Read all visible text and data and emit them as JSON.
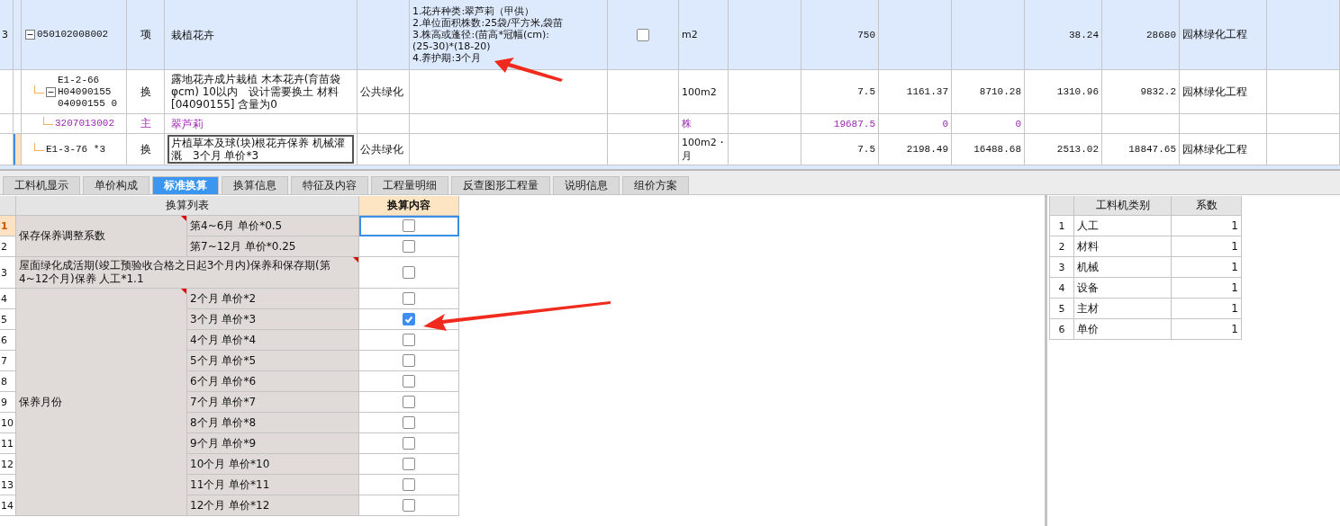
{
  "bill_table": {
    "rows": [
      {
        "kind": "bill",
        "num": "3",
        "code": "050102008002",
        "type": "项",
        "name": "栽植花卉",
        "features": [
          "1.花卉种类:翠芦莉（甲供）",
          "2.单位面积株数:25袋/平方米,袋苗",
          "3.株高或蓬径:(苗高*冠幅(cm):",
          "(25-30)*(18-20)",
          "4.养护期:3个月"
        ],
        "checked": false,
        "unit": "m2",
        "quantity": "750",
        "column_14": "38.24",
        "column_15": "28680",
        "specialty": "园林绿化工程",
        "selected": false,
        "expanded": true,
        "children": [
          {
            "kind": "quota",
            "code": "E1-2-66 H04090155 04090155 0",
            "type": "换",
            "name": "露地花卉成片栽植 木本花卉(育苗袋φcm) 10以内　设计需要换土 材料[04090155] 含量为0",
            "category": "公共绿化",
            "unit": "100m2",
            "quantity": "7.5",
            "column_12": "1161.37",
            "column_13": "8710.28",
            "column_14": "1310.96",
            "column_15": "9832.2",
            "specialty": "园林绿化工程",
            "selected": false,
            "expanded": true,
            "children": [
              {
                "kind": "material",
                "code": "3207013002",
                "type": "主",
                "name": "翠芦莉",
                "unit": "株",
                "quantity": "19687.5",
                "column_12": "0",
                "column_13": "0",
                "selected": false
              }
            ]
          },
          {
            "kind": "quota",
            "code": "E1-3-76 *3",
            "type": "换",
            "name": "片植草本及球(块)根花卉保养 机械灌溉　3个月 单价*3",
            "category": "公共绿化",
            "unit": "100m2・月",
            "quantity": "7.5",
            "column_12": "2198.49",
            "column_13": "16488.68",
            "column_14": "2513.02",
            "column_15": "18847.65",
            "specialty": "园林绿化工程",
            "selected": true
          }
        ]
      }
    ]
  },
  "tabs": [
    {
      "label": "工料机显示",
      "selected": false
    },
    {
      "label": "单价构成",
      "selected": false
    },
    {
      "label": "标准换算",
      "selected": true
    },
    {
      "label": "换算信息",
      "selected": false
    },
    {
      "label": "特征及内容",
      "selected": false
    },
    {
      "label": "工程量明细",
      "selected": false
    },
    {
      "label": "反查图形工程量",
      "selected": false
    },
    {
      "label": "说明信息",
      "selected": false
    },
    {
      "label": "组价方案",
      "selected": false
    }
  ],
  "conversion_table": {
    "columns": [
      "换算列表",
      "换算内容"
    ],
    "groups": [
      {
        "kind": "grouped",
        "label": "保存保养调整系数",
        "note_mark": true,
        "rows": [
          {
            "num": "1",
            "item": "第4~6月 单价*0.5",
            "checked": false,
            "selected": true
          },
          {
            "num": "2",
            "item": "第7~12月 单价*0.25",
            "checked": false,
            "selected": false
          }
        ]
      },
      {
        "kind": "merged",
        "label": "屋面绿化成活期(竣工预验收合格之日起3个月内)保养和保存期(第4~12个月)保养 人工*1.1",
        "note_mark": true,
        "rows": [
          {
            "num": "3",
            "checked": false,
            "selected": false
          }
        ]
      },
      {
        "kind": "grouped",
        "label": "保养月份",
        "note_mark": true,
        "rows": [
          {
            "num": "4",
            "item": "2个月 单价*2",
            "checked": false,
            "selected": false
          },
          {
            "num": "5",
            "item": "3个月 单价*3",
            "checked": true,
            "selected": false
          },
          {
            "num": "6",
            "item": "4个月 单价*4",
            "checked": false,
            "selected": false
          },
          {
            "num": "7",
            "item": "5个月 单价*5",
            "checked": false,
            "selected": false
          },
          {
            "num": "8",
            "item": "6个月 单价*6",
            "checked": false,
            "selected": false
          },
          {
            "num": "9",
            "item": "7个月 单价*7",
            "checked": false,
            "selected": false
          },
          {
            "num": "10",
            "item": "8个月 单价*8",
            "checked": false,
            "selected": false
          },
          {
            "num": "11",
            "item": "9个月 单价*9",
            "checked": false,
            "selected": false
          },
          {
            "num": "12",
            "item": "10个月 单价*10",
            "checked": false,
            "selected": false
          },
          {
            "num": "13",
            "item": "11个月 单价*11",
            "checked": false,
            "selected": false
          },
          {
            "num": "14",
            "item": "12个月 单价*12",
            "checked": false,
            "selected": false
          }
        ]
      }
    ]
  },
  "coefficient_table": {
    "columns": [
      "工料机类别",
      "系数"
    ],
    "rows": [
      {
        "num": "1",
        "category": "人工",
        "value": "1"
      },
      {
        "num": "2",
        "category": "材料",
        "value": "1"
      },
      {
        "num": "3",
        "category": "机械",
        "value": "1"
      },
      {
        "num": "4",
        "category": "设备",
        "value": "1"
      },
      {
        "num": "5",
        "category": "主材",
        "value": "1"
      },
      {
        "num": "6",
        "category": "单价",
        "value": "1"
      }
    ]
  }
}
